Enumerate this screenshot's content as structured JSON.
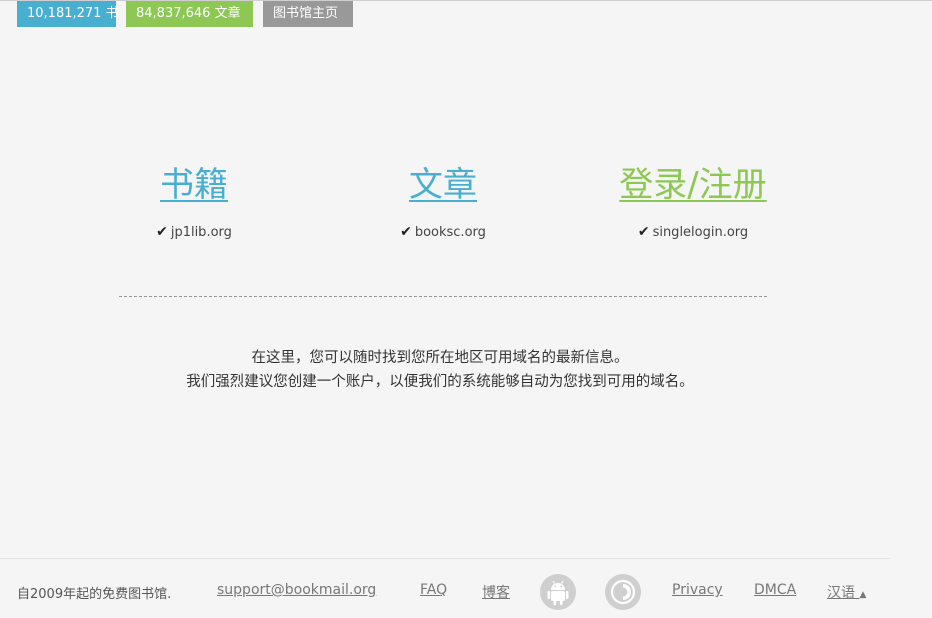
{
  "header": {
    "books_count_label": "10,181,271 书",
    "articles_count_label": "84,837,646 文章",
    "library_home_label": "图书馆主页"
  },
  "sections": [
    {
      "title": "书籍",
      "domain": "jp1lib.org"
    },
    {
      "title": "文章",
      "domain": "booksc.org"
    },
    {
      "title": "登录/注册",
      "domain": "singlelogin.org"
    }
  ],
  "info": {
    "line1": "在这里，您可以随时找到您所在地区可用域名的最新信息。",
    "line2": "我们强烈建议您创建一个账户，以便我们的系统能够自动为您找到可用的域名。"
  },
  "footer": {
    "tagline": "自2009年起的免费图书馆.",
    "email": "support@bookmail.org",
    "faq": "FAQ",
    "blog": "博客",
    "privacy": "Privacy",
    "dmca": "DMCA",
    "language": "汉语"
  },
  "icons": {
    "check": "checkmark-icon",
    "android": "android-icon",
    "tor": "tor-icon",
    "language_caret": "caret-up-icon"
  },
  "colors": {
    "blue": "#49afd0",
    "green": "#8cc853",
    "gray": "#999999",
    "background": "#f5f5f5"
  }
}
